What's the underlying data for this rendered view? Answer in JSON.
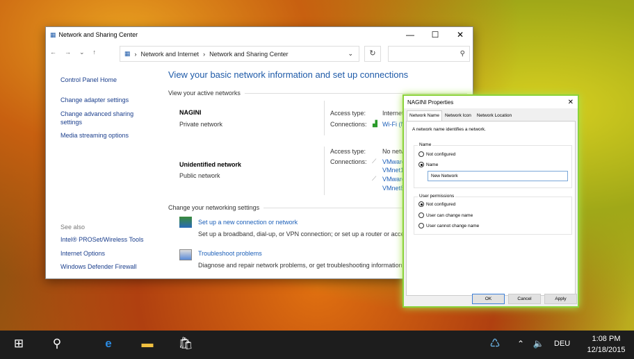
{
  "window": {
    "title": "Network and Sharing Center",
    "breadcrumb": [
      "Network and Internet",
      "Network and Sharing Center"
    ]
  },
  "sidebar": {
    "items": [
      "Control Panel Home",
      "Change adapter settings",
      "Change advanced sharing settings",
      "Media streaming options"
    ],
    "see_also_label": "See also",
    "see_also": [
      "Intel® PROSet/Wireless Tools",
      "Internet Options",
      "Windows Defender Firewall"
    ]
  },
  "main": {
    "heading": "View your basic network information and set up connections",
    "active_label": "View your active networks",
    "networks": [
      {
        "name": "NAGINI",
        "type": "Private network",
        "access_label": "Access type:",
        "access": "Internet",
        "conn_label": "Connections:",
        "connections": [
          "Wi-Fi (NAGINI)"
        ]
      },
      {
        "name": "Unidentified network",
        "type": "Public network",
        "access_label": "Access type:",
        "access": "No network access",
        "conn_label": "Connections:",
        "connections": [
          "VMware Network Adapter",
          "VMnet1",
          "VMware Network Adapter",
          "VMnet8"
        ]
      }
    ],
    "change_label": "Change your networking settings",
    "tasks": [
      {
        "link": "Set up a new connection or network",
        "desc": "Set up a broadband, dial-up, or VPN connection; or set up a router or access point."
      },
      {
        "link": "Troubleshoot problems",
        "desc": "Diagnose and repair network problems, or get troubleshooting information."
      }
    ]
  },
  "dialog": {
    "title": "NAGINI Properties",
    "tabs": [
      "Network Name",
      "Network Icon",
      "Network Location"
    ],
    "intro": "A network name identifies a network.",
    "name_group": "Name",
    "name_options": [
      "Not configured",
      "Name"
    ],
    "name_value": "New Network",
    "perm_group": "User permissions",
    "perm_options": [
      "Not configured",
      "User can change name",
      "User cannot change name"
    ],
    "buttons": {
      "ok": "OK",
      "cancel": "Cancel",
      "apply": "Apply"
    }
  },
  "taskbar": {
    "lang": "DEU",
    "time": "1:08 PM",
    "date": "12/18/2015"
  }
}
